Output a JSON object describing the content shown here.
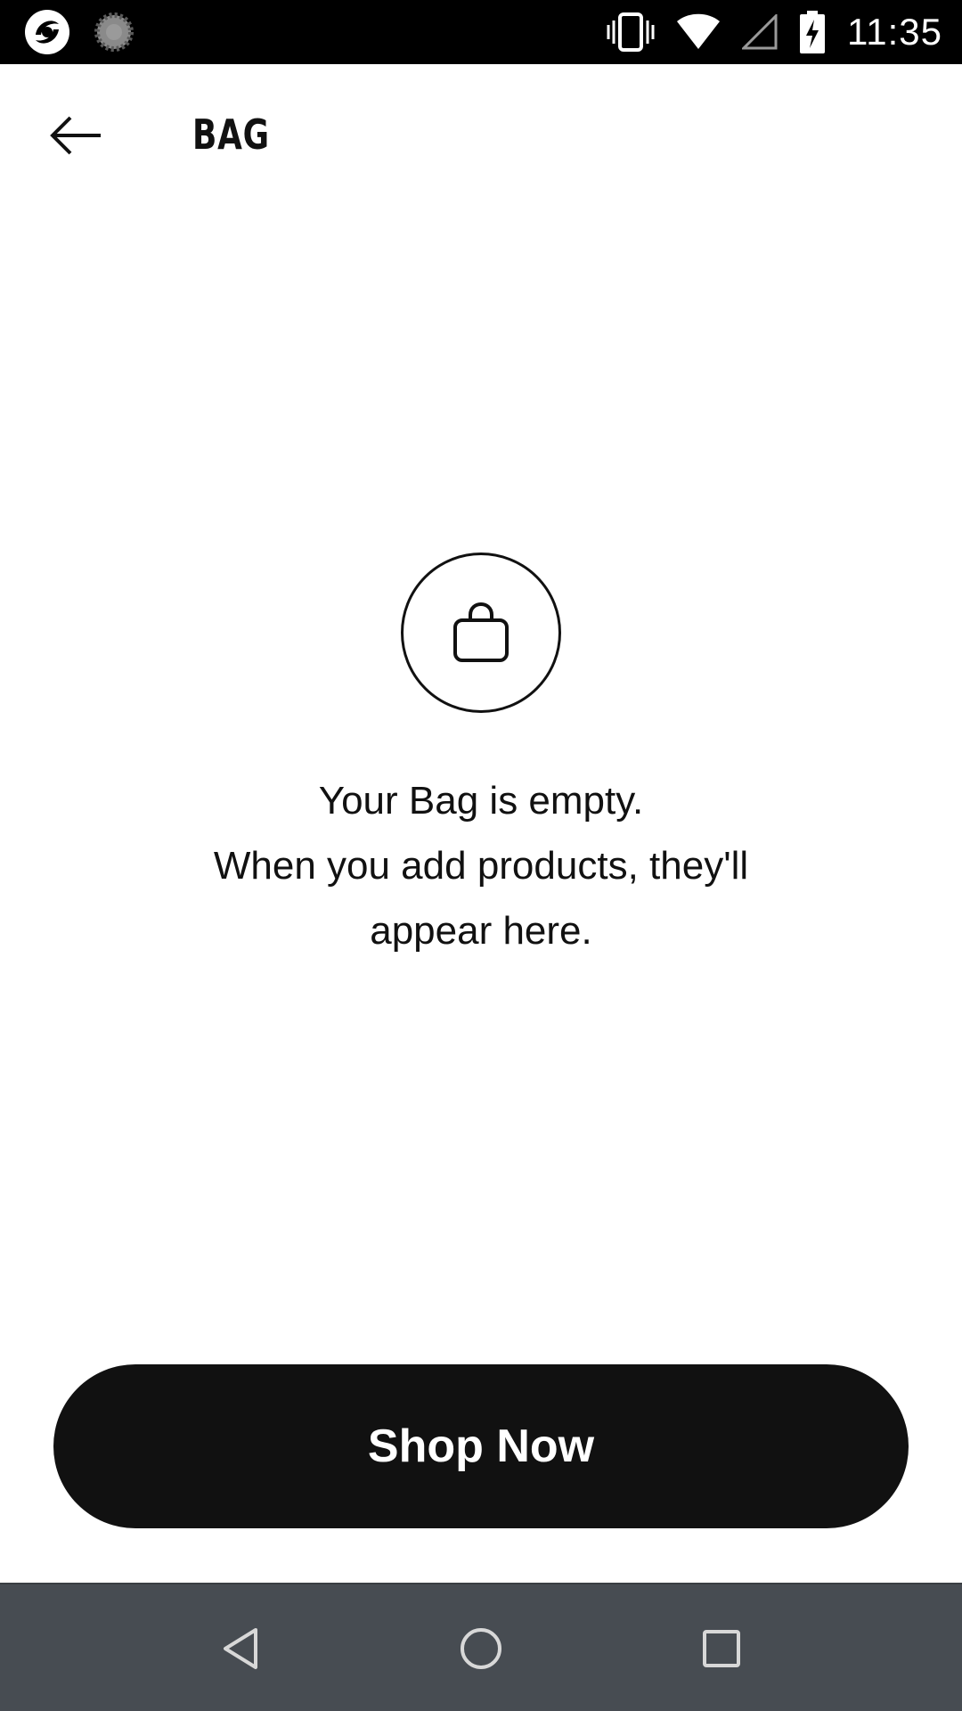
{
  "status_bar": {
    "time": "11:35",
    "left_icons": [
      "app-notification-icon",
      "loading-spinner-icon"
    ],
    "right_icons": [
      "vibrate-icon",
      "wifi-icon",
      "cell-signal-icon",
      "battery-charging-icon"
    ]
  },
  "app_bar": {
    "back_icon": "arrow-left-icon",
    "title": "BAG"
  },
  "empty_state": {
    "icon": "shopping-bag-icon",
    "line1": "Your Bag is empty.",
    "line2": "When you add products, they'll",
    "line3": "appear here."
  },
  "primary_action": {
    "label": "Shop Now"
  },
  "nav_bar": {
    "buttons": [
      "back-triangle-icon",
      "home-circle-icon",
      "recents-square-icon"
    ]
  },
  "colors": {
    "status_bar_bg": "#000000",
    "text": "#111111",
    "button_bg": "#111111",
    "button_text": "#ffffff",
    "nav_bar_bg": "#474c52"
  }
}
